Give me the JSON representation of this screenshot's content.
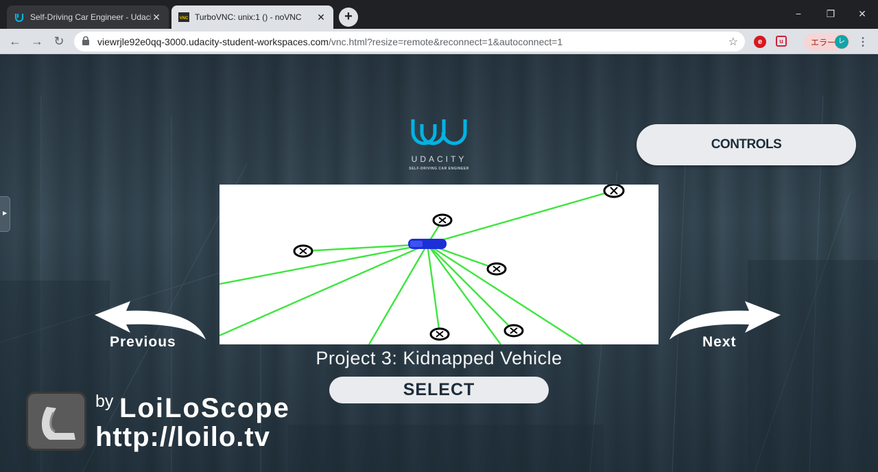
{
  "tabs": [
    {
      "title": "Self-Driving Car Engineer - Udaci",
      "icon": "udacity-icon",
      "active": false
    },
    {
      "title": "TurboVNC: unix:1 () - noVNC",
      "icon": "vnc-icon",
      "active": true
    }
  ],
  "new_tab_label": "+",
  "window_controls": {
    "minimize": "−",
    "restore": "❐",
    "close": "✕"
  },
  "tab_close": "✕",
  "nav": {
    "back": "←",
    "forward": "→",
    "reload": "↻"
  },
  "address": {
    "host": "viewrjle92e0qq-3000.udacity-student-workspaces.com",
    "path": "/vnc.html?resize=remote&reconnect=1&autoconnect=1"
  },
  "bookmark_icon": "☆",
  "profile": {
    "label": "エラー",
    "avatar": "レ"
  },
  "menu_icon": "⋮",
  "app": {
    "logo_word": "UDACITY",
    "logo_sub": "SELF-DRIVING CAR ENGINEER",
    "controls_button": "CONTROLS",
    "previous_label": "Previous",
    "next_label": "Next",
    "project_title": "Project 3: Kidnapped Vehicle",
    "select_button": "SELECT"
  },
  "watermark": {
    "by": "by",
    "brand": "LoiLoScope",
    "url": "http://loilo.tv"
  },
  "colors": {
    "tabbar": "#202124",
    "toolbar": "#dee1e6",
    "laser": "#3ee63e",
    "car": "#1a2fd6",
    "udacity_blue": "#02b3e4"
  }
}
